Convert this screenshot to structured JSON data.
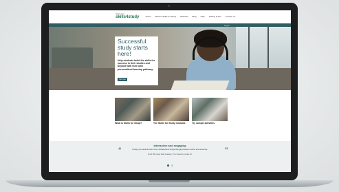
{
  "site": {
    "logo_small": "Open Uni",
    "logo_main": "skills4study"
  },
  "nav": {
    "items": [
      "Home",
      "What is Skills for Study",
      "Modules",
      "Blog",
      "Help",
      "Pricing & Info",
      "Contact us"
    ],
    "login": "Log in"
  },
  "hero": {
    "title": "Successful study starts here!",
    "text": "Help students build the skills for success in their studies and beyond with their own personalised learning pathway.",
    "button": "Find out"
  },
  "cards": [
    {
      "label": "What is Skills for Study?"
    },
    {
      "label": "The Skills for Study modules"
    },
    {
      "label": "Try sample activities"
    }
  ],
  "testimonial": {
    "title": "Interactive and engaging",
    "quote": "It helps you students feel more motivated and brings that gap between school and university.",
    "cite": "South Hills Study Skills Academic, The University of East UK",
    "open_mark": "“",
    "close_mark": "”"
  },
  "colors": {
    "brand_teal": "#2e5e64",
    "logo_green": "#1f7a4f"
  }
}
